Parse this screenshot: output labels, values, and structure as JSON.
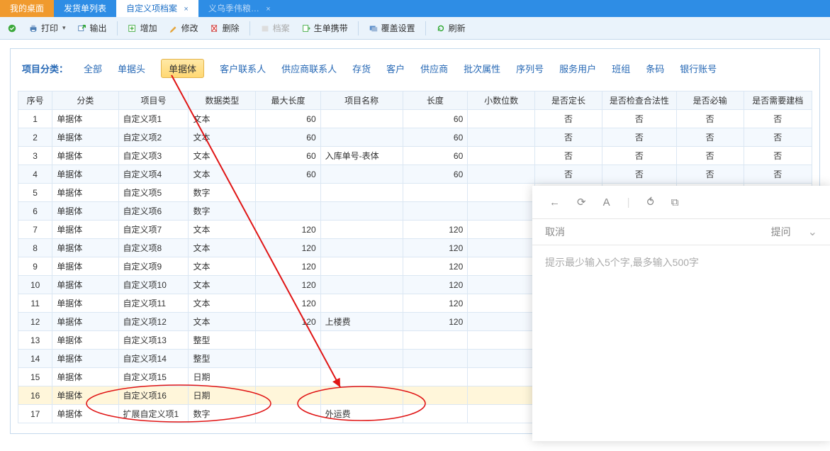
{
  "tabs": [
    {
      "label": "我的桌面",
      "style": "orange"
    },
    {
      "label": "发货单列表",
      "style": "blue"
    },
    {
      "label": "自定义项档案",
      "style": "active",
      "closable": true
    },
    {
      "label": "义乌季伟粮…",
      "style": "blue",
      "closable": true
    }
  ],
  "toolbar": {
    "print": "打印",
    "export": "输出",
    "add": "增加",
    "edit": "修改",
    "delete": "删除",
    "archive": "档案",
    "gen": "生单携带",
    "cover": "覆盖设置",
    "refresh": "刷新"
  },
  "filter": {
    "label": "项目分类：",
    "items": [
      "全部",
      "单据头",
      "单据体",
      "客户联系人",
      "供应商联系人",
      "存货",
      "客户",
      "供应商",
      "批次属性",
      "序列号",
      "服务用户",
      "班组",
      "条码",
      "银行账号"
    ],
    "active_index": 2
  },
  "columns": [
    "序号",
    "分类",
    "项目号",
    "数据类型",
    "最大长度",
    "项目名称",
    "长度",
    "小数位数",
    "是否定长",
    "是否检查合法性",
    "是否必输",
    "是否需要建档"
  ],
  "rows": [
    {
      "seq": 1,
      "cat": "单据体",
      "id": "自定义项1",
      "type": "文本",
      "max": 60,
      "name": "",
      "len": 60,
      "dec": "",
      "fl": "否",
      "chk": "否",
      "req": "否",
      "doc": "否"
    },
    {
      "seq": 2,
      "cat": "单据体",
      "id": "自定义项2",
      "type": "文本",
      "max": 60,
      "name": "",
      "len": 60,
      "dec": "",
      "fl": "否",
      "chk": "否",
      "req": "否",
      "doc": "否"
    },
    {
      "seq": 3,
      "cat": "单据体",
      "id": "自定义项3",
      "type": "文本",
      "max": 60,
      "name": "入库单号-表体",
      "len": 60,
      "dec": "",
      "fl": "否",
      "chk": "否",
      "req": "否",
      "doc": "否"
    },
    {
      "seq": 4,
      "cat": "单据体",
      "id": "自定义项4",
      "type": "文本",
      "max": 60,
      "name": "",
      "len": 60,
      "dec": "",
      "fl": "否",
      "chk": "否",
      "req": "否",
      "doc": "否"
    },
    {
      "seq": 5,
      "cat": "单据体",
      "id": "自定义项5",
      "type": "数字",
      "max": "",
      "name": "",
      "len": "",
      "dec": "",
      "fl": "",
      "chk": "",
      "req": "",
      "doc": ""
    },
    {
      "seq": 6,
      "cat": "单据体",
      "id": "自定义项6",
      "type": "数字",
      "max": "",
      "name": "",
      "len": "",
      "dec": "",
      "fl": "",
      "chk": "",
      "req": "",
      "doc": ""
    },
    {
      "seq": 7,
      "cat": "单据体",
      "id": "自定义项7",
      "type": "文本",
      "max": 120,
      "name": "",
      "len": 120,
      "dec": "",
      "fl": "",
      "chk": "",
      "req": "",
      "doc": ""
    },
    {
      "seq": 8,
      "cat": "单据体",
      "id": "自定义项8",
      "type": "文本",
      "max": 120,
      "name": "",
      "len": 120,
      "dec": "",
      "fl": "",
      "chk": "",
      "req": "",
      "doc": ""
    },
    {
      "seq": 9,
      "cat": "单据体",
      "id": "自定义项9",
      "type": "文本",
      "max": 120,
      "name": "",
      "len": 120,
      "dec": "",
      "fl": "",
      "chk": "",
      "req": "",
      "doc": ""
    },
    {
      "seq": 10,
      "cat": "单据体",
      "id": "自定义项10",
      "type": "文本",
      "max": 120,
      "name": "",
      "len": 120,
      "dec": "",
      "fl": "",
      "chk": "",
      "req": "",
      "doc": ""
    },
    {
      "seq": 11,
      "cat": "单据体",
      "id": "自定义项11",
      "type": "文本",
      "max": 120,
      "name": "",
      "len": 120,
      "dec": "",
      "fl": "",
      "chk": "",
      "req": "",
      "doc": ""
    },
    {
      "seq": 12,
      "cat": "单据体",
      "id": "自定义项12",
      "type": "文本",
      "max": 120,
      "name": "上楼费",
      "len": 120,
      "dec": "",
      "fl": "",
      "chk": "",
      "req": "",
      "doc": ""
    },
    {
      "seq": 13,
      "cat": "单据体",
      "id": "自定义项13",
      "type": "整型",
      "max": "",
      "name": "",
      "len": "",
      "dec": "",
      "fl": "",
      "chk": "",
      "req": "",
      "doc": ""
    },
    {
      "seq": 14,
      "cat": "单据体",
      "id": "自定义项14",
      "type": "整型",
      "max": "",
      "name": "",
      "len": "",
      "dec": "",
      "fl": "",
      "chk": "",
      "req": "",
      "doc": ""
    },
    {
      "seq": 15,
      "cat": "单据体",
      "id": "自定义项15",
      "type": "日期",
      "max": "",
      "name": "",
      "len": "",
      "dec": "",
      "fl": "",
      "chk": "",
      "req": "",
      "doc": ""
    },
    {
      "seq": 16,
      "cat": "单据体",
      "id": "自定义项16",
      "type": "日期",
      "max": "",
      "name": "",
      "len": "",
      "dec": "",
      "fl": "",
      "chk": "",
      "req": "",
      "doc": "",
      "highlight": true
    },
    {
      "seq": 17,
      "cat": "单据体",
      "id": "扩展自定义项1",
      "type": "数字",
      "max": "",
      "name": "外运费",
      "len": "",
      "dec": "",
      "fl": "",
      "chk": "",
      "req": "",
      "doc": ""
    }
  ],
  "side_panel": {
    "cancel": "取消",
    "ask": "提问",
    "hint": "提示最少输入5个字,最多输入500字",
    "icons": {
      "back": "back-arrow-icon",
      "refresh": "refresh-icon",
      "font": "font-icon",
      "link": "link-icon",
      "window": "window-icon"
    }
  }
}
